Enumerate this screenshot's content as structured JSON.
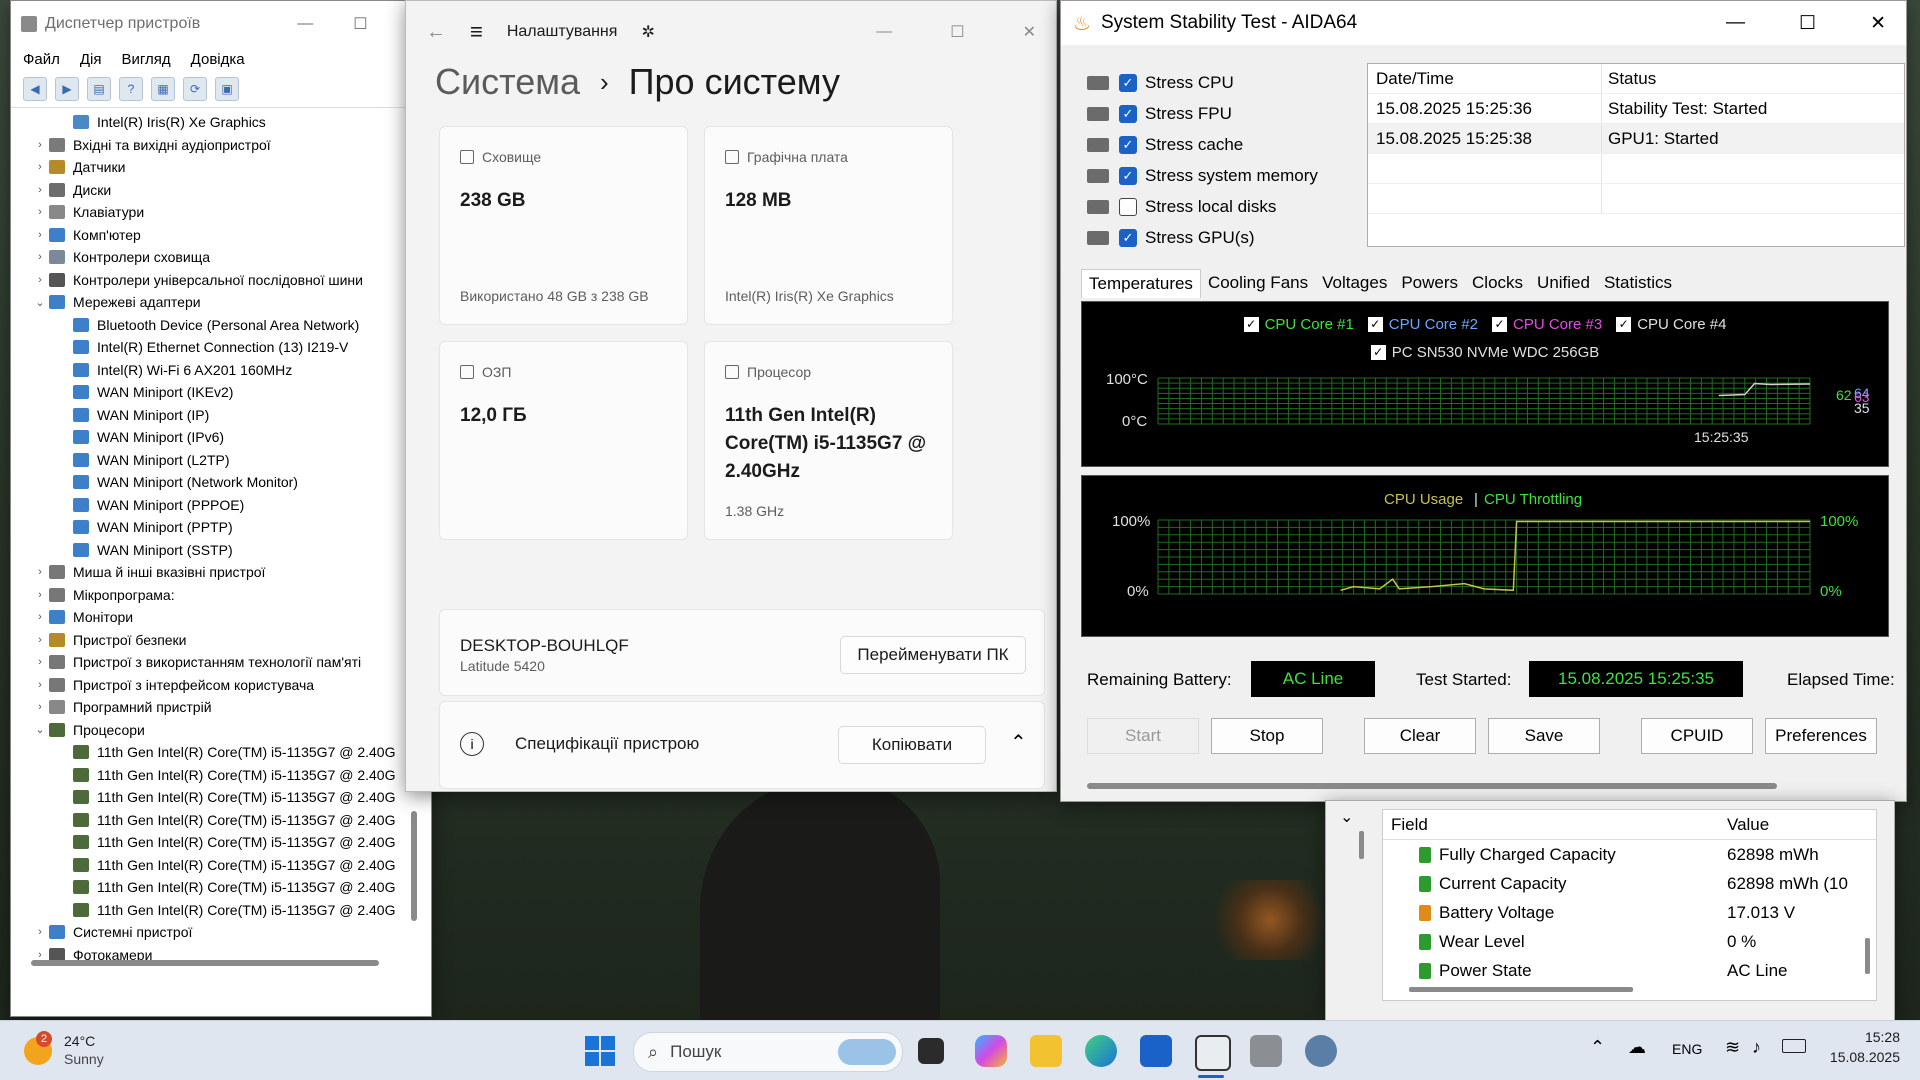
{
  "devmgr": {
    "title": "Диспетчер пристроїв",
    "menu": [
      "Файл",
      "Дія",
      "Вигляд",
      "Довідка"
    ],
    "tree": [
      {
        "label": "Intel(R) Iris(R) Xe Graphics",
        "level": 2,
        "arrow": "",
        "color": "#4a88c7"
      },
      {
        "label": "Вхідні та вихідні аудіопристрої",
        "level": 1,
        "arrow": "›",
        "color": "#7a7a7a"
      },
      {
        "label": "Датчики",
        "level": 1,
        "arrow": "›",
        "color": "#b58b2a"
      },
      {
        "label": "Диски",
        "level": 1,
        "arrow": "›",
        "color": "#6d6d6d"
      },
      {
        "label": "Клавіатури",
        "level": 1,
        "arrow": "›",
        "color": "#888"
      },
      {
        "label": "Комп'ютер",
        "level": 1,
        "arrow": "›",
        "color": "#3e7fc9"
      },
      {
        "label": "Контролери сховища",
        "level": 1,
        "arrow": "›",
        "color": "#7a8a9a"
      },
      {
        "label": "Контролери універсальної послідовної шини",
        "level": 1,
        "arrow": "›",
        "color": "#555"
      },
      {
        "label": "Мережеві адаптери",
        "level": 1,
        "arrow": "⌄",
        "color": "#3e7fc9"
      },
      {
        "label": "Bluetooth Device (Personal Area Network)",
        "level": 2,
        "arrow": "",
        "color": "#3e7fc9"
      },
      {
        "label": "Intel(R) Ethernet Connection (13) I219-V",
        "level": 2,
        "arrow": "",
        "color": "#3e7fc9"
      },
      {
        "label": "Intel(R) Wi-Fi 6 AX201 160MHz",
        "level": 2,
        "arrow": "",
        "color": "#3e7fc9"
      },
      {
        "label": "WAN Miniport (IKEv2)",
        "level": 2,
        "arrow": "",
        "color": "#3e7fc9"
      },
      {
        "label": "WAN Miniport (IP)",
        "level": 2,
        "arrow": "",
        "color": "#3e7fc9"
      },
      {
        "label": "WAN Miniport (IPv6)",
        "level": 2,
        "arrow": "",
        "color": "#3e7fc9"
      },
      {
        "label": "WAN Miniport (L2TP)",
        "level": 2,
        "arrow": "",
        "color": "#3e7fc9"
      },
      {
        "label": "WAN Miniport (Network Monitor)",
        "level": 2,
        "arrow": "",
        "color": "#3e7fc9"
      },
      {
        "label": "WAN Miniport (PPPOE)",
        "level": 2,
        "arrow": "",
        "color": "#3e7fc9"
      },
      {
        "label": "WAN Miniport (PPTP)",
        "level": 2,
        "arrow": "",
        "color": "#3e7fc9"
      },
      {
        "label": "WAN Miniport (SSTP)",
        "level": 2,
        "arrow": "",
        "color": "#3e7fc9"
      },
      {
        "label": "Миша й інші вказівні пристрої",
        "level": 1,
        "arrow": "›",
        "color": "#777"
      },
      {
        "label": "Мікропрограма:",
        "level": 1,
        "arrow": "›",
        "color": "#777"
      },
      {
        "label": "Монітори",
        "level": 1,
        "arrow": "›",
        "color": "#3e7fc9"
      },
      {
        "label": "Пристрої безпеки",
        "level": 1,
        "arrow": "›",
        "color": "#b58b2a"
      },
      {
        "label": "Пристрої з використанням технології пам'яті",
        "level": 1,
        "arrow": "›",
        "color": "#777"
      },
      {
        "label": "Пристрої з інтерфейсом користувача",
        "level": 1,
        "arrow": "›",
        "color": "#777"
      },
      {
        "label": "Програмний пристрій",
        "level": 1,
        "arrow": "›",
        "color": "#888"
      },
      {
        "label": "Процесори",
        "level": 1,
        "arrow": "⌄",
        "color": "#4d6b3a"
      },
      {
        "label": "11th Gen Intel(R) Core(TM) i5-1135G7 @ 2.40G",
        "level": 2,
        "arrow": "",
        "color": "#4d6b3a"
      },
      {
        "label": "11th Gen Intel(R) Core(TM) i5-1135G7 @ 2.40G",
        "level": 2,
        "arrow": "",
        "color": "#4d6b3a"
      },
      {
        "label": "11th Gen Intel(R) Core(TM) i5-1135G7 @ 2.40G",
        "level": 2,
        "arrow": "",
        "color": "#4d6b3a"
      },
      {
        "label": "11th Gen Intel(R) Core(TM) i5-1135G7 @ 2.40G",
        "level": 2,
        "arrow": "",
        "color": "#4d6b3a"
      },
      {
        "label": "11th Gen Intel(R) Core(TM) i5-1135G7 @ 2.40G",
        "level": 2,
        "arrow": "",
        "color": "#4d6b3a"
      },
      {
        "label": "11th Gen Intel(R) Core(TM) i5-1135G7 @ 2.40G",
        "level": 2,
        "arrow": "",
        "color": "#4d6b3a"
      },
      {
        "label": "11th Gen Intel(R) Core(TM) i5-1135G7 @ 2.40G",
        "level": 2,
        "arrow": "",
        "color": "#4d6b3a"
      },
      {
        "label": "11th Gen Intel(R) Core(TM) i5-1135G7 @ 2.40G",
        "level": 2,
        "arrow": "",
        "color": "#4d6b3a"
      },
      {
        "label": "Системні пристрої",
        "level": 1,
        "arrow": "›",
        "color": "#3e7fc9"
      },
      {
        "label": "Фотокамери",
        "level": 1,
        "arrow": "›",
        "color": "#555"
      }
    ]
  },
  "settings": {
    "title": "Налаштування",
    "crumb_parent": "Система",
    "crumb_current": "Про систему",
    "storage": {
      "label": "Сховище",
      "value": "238 GB",
      "sub": "Використано 48 GB з 238 GB"
    },
    "gpu": {
      "label": "Графічна плата",
      "value": "128 MB",
      "sub": "Intel(R) Iris(R) Xe Graphics"
    },
    "ram": {
      "label": "ОЗП",
      "value": "12,0 ГБ"
    },
    "cpu": {
      "label": "Процесор",
      "value": "11th Gen Intel(R) Core(TM) i5-1135G7 @ 2.40GHz",
      "sub": "1.38 GHz"
    },
    "device_name": "DESKTOP-BOUHLQF",
    "device_model": "Latitude 5420",
    "rename_btn": "Перейменувати ПК",
    "spec_label": "Специфікації пристрою",
    "copy_btn": "Копіювати",
    "info_glyph": "i",
    "back_glyph": "←",
    "menu_glyph": "≡",
    "chev_glyph": "›",
    "collapse_glyph": "⌃"
  },
  "aida": {
    "title": "System Stability Test - AIDA64",
    "stress": [
      {
        "label": "Stress CPU",
        "checked": true
      },
      {
        "label": "Stress FPU",
        "checked": true
      },
      {
        "label": "Stress cache",
        "checked": true
      },
      {
        "label": "Stress system memory",
        "checked": true
      },
      {
        "label": "Stress local disks",
        "checked": false
      },
      {
        "label": "Stress GPU(s)",
        "checked": true
      }
    ],
    "log_headers": [
      "Date/Time",
      "Status"
    ],
    "log_rows": [
      [
        "15.08.2025 15:25:36",
        "Stability Test: Started"
      ],
      [
        "15.08.2025 15:25:38",
        "GPU1: Started"
      ]
    ],
    "tabs": [
      "Temperatures",
      "Cooling Fans",
      "Voltages",
      "Powers",
      "Clocks",
      "Unified",
      "Statistics"
    ],
    "temp_legend": [
      {
        "label": "CPU Core #1",
        "color": "#3de23d"
      },
      {
        "label": "CPU Core #2",
        "color": "#6aa8ff"
      },
      {
        "label": "CPU Core #3",
        "color": "#e24de2"
      },
      {
        "label": "CPU Core #4",
        "color": "#e0e0e0"
      },
      {
        "label": "PC SN530 NVMe WDC 256GB",
        "color": "#e0e0e0"
      }
    ],
    "temp_ymax": "100°C",
    "temp_ymin": "0°C",
    "temp_time": "15:25:35",
    "temp_readings": [
      "62",
      "64",
      "63",
      "35"
    ],
    "usage_label": "CPU Usage",
    "usage_sep": "|",
    "throttle_label": "CPU Throttling",
    "usage_ymax": "100%",
    "usage_ymin": "0%",
    "battery_label": "Remaining Battery:",
    "battery_value": "AC Line",
    "test_started_label": "Test Started:",
    "test_started_value": "15.08.2025 15:25:35",
    "elapsed_label": "Elapsed Time:",
    "buttons": [
      "Start",
      "Stop",
      "Clear",
      "Save",
      "CPUID",
      "Preferences"
    ]
  },
  "battery": {
    "headers": [
      "Field",
      "Value"
    ],
    "rows": [
      {
        "field": "Fully Charged Capacity",
        "value": "62898 mWh"
      },
      {
        "field": "Current Capacity",
        "value": "62898 mWh  (10"
      },
      {
        "field": "Battery Voltage",
        "value": "17.013 V"
      },
      {
        "field": "Wear Level",
        "value": "0 %"
      },
      {
        "field": "Power State",
        "value": "AC Line"
      }
    ]
  },
  "taskbar": {
    "weather_temp": "24°C",
    "weather_desc": "Sunny",
    "weather_badge": "2",
    "search_placeholder": "Пошук",
    "lang": "ENG",
    "time": "15:28",
    "date": "15.08.2025"
  }
}
